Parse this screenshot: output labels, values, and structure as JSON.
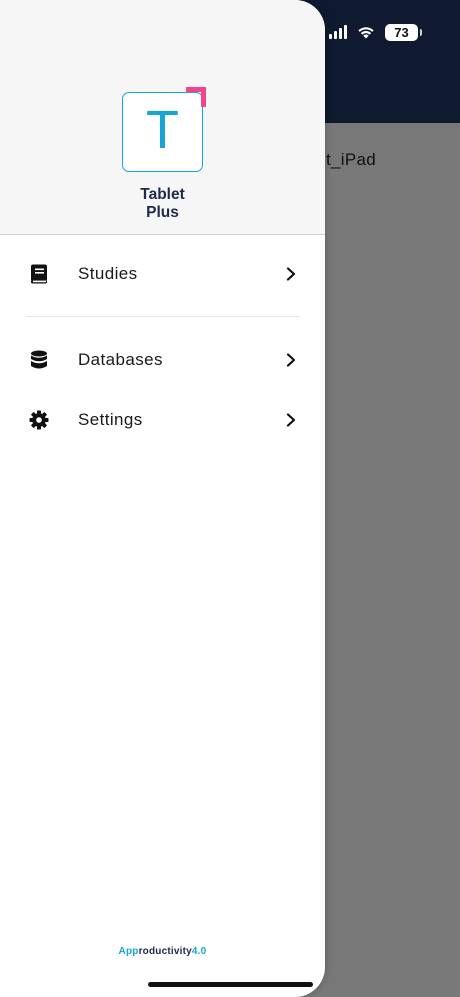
{
  "background": {
    "content_text": "t_iPad"
  },
  "status_bar": {
    "battery_level": "73",
    "icons": [
      "signal-icon",
      "wifi-icon",
      "battery-icon"
    ]
  },
  "drawer": {
    "logo_letter": "T",
    "app_name_line1": "Tablet",
    "app_name_line2": "Plus",
    "menu": [
      {
        "label": "Studies",
        "icon": "book-icon"
      },
      {
        "label": "Databases",
        "icon": "database-icon"
      },
      {
        "label": "Settings",
        "icon": "gear-icon"
      }
    ],
    "footer_part1": "App",
    "footer_part2": "roductivity",
    "footer_part3": "4.0"
  },
  "colors": {
    "accent_blue": "#1aa3d6",
    "accent_pink": "#f2448a",
    "header_dark": "#0f1a30",
    "overlay_gray": "#787878",
    "brand_navy": "#1d2a4a"
  }
}
